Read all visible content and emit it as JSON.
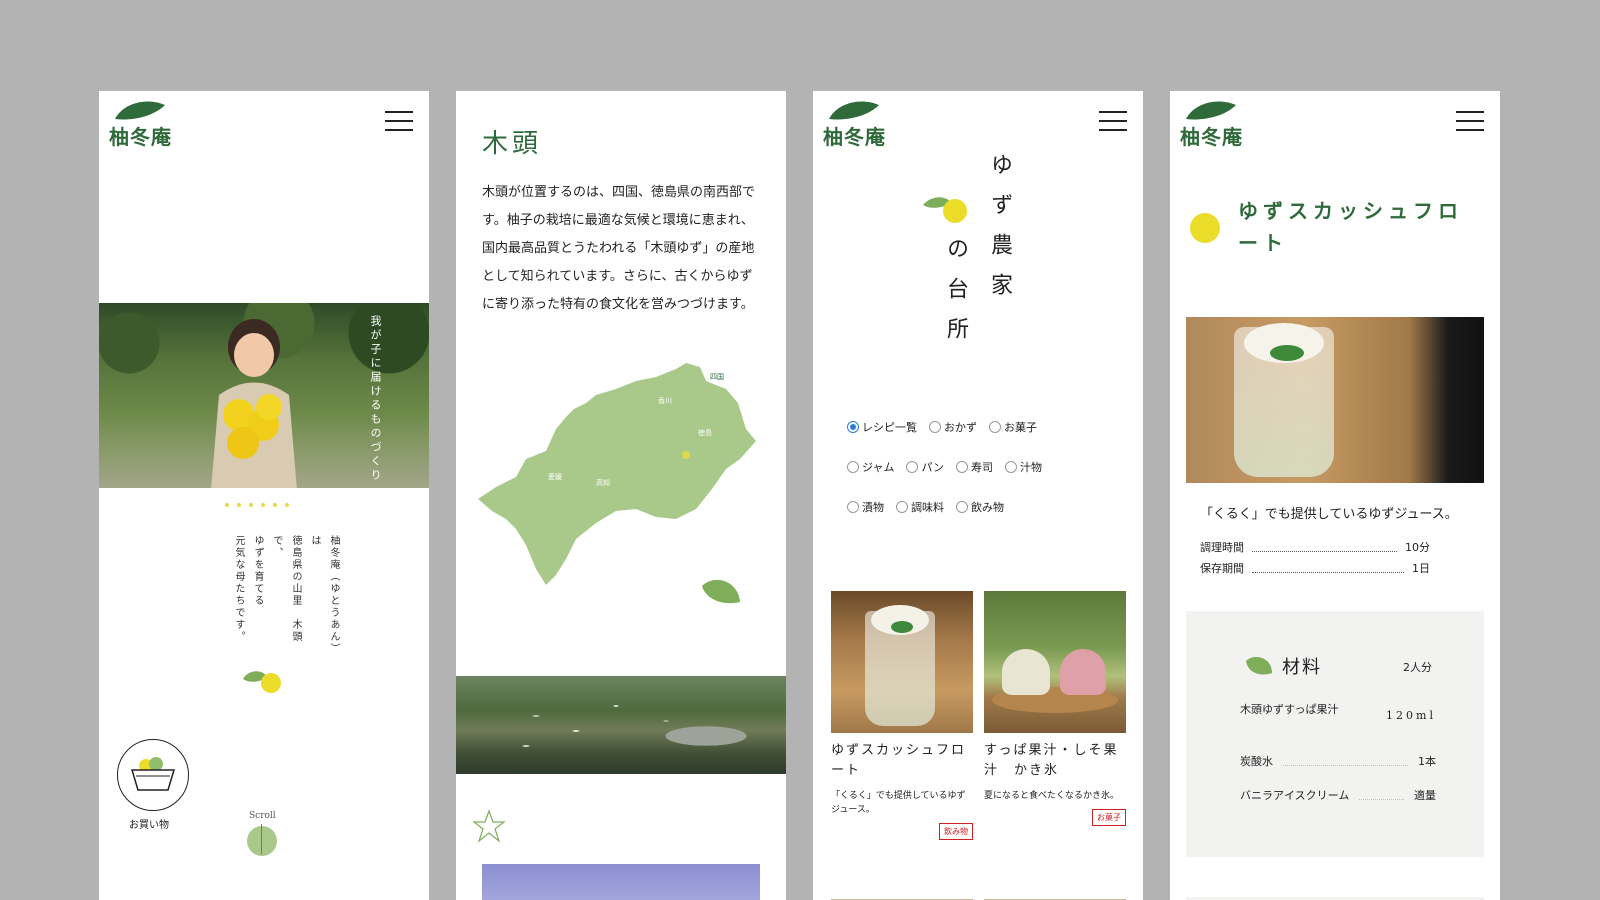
{
  "brand": {
    "logo_text": "柚冬庵",
    "green": "#2f6b3a",
    "yuzu_yellow": "#ecdc2a"
  },
  "screen1": {
    "hero_tagline": "我が子に届けるものづくり",
    "intro_lines": [
      "柚冬庵（ゆとうあん）は",
      "徳島県の山里　木頭で、",
      "ゆずを育てる",
      "元気な母たちです。"
    ],
    "shop_label": "お買い物",
    "scroll_label": "Scroll"
  },
  "screen2": {
    "title": "木頭",
    "body": "木頭が位置するのは、四国、徳島県の南西部です。柚子の栽培に最適な気候と環境に恵まれ、国内最高品質とうたわれる「木頭ゆず」の産地として知られています。さらに、古くからゆずに寄り添った特有の食文化を営みつづけます。",
    "map_labels": {
      "shikoku": "四国",
      "kagawa": "香川",
      "tokushima": "徳島",
      "ehime": "愛媛",
      "kochi": "高知"
    }
  },
  "screen3": {
    "title_col1": "ゆず農家",
    "title_col2": "の台所",
    "filters": [
      [
        {
          "label": "レシピ一覧",
          "checked": true
        },
        {
          "label": "おかず",
          "checked": false
        },
        {
          "label": "お菓子",
          "checked": false
        }
      ],
      [
        {
          "label": "ジャム",
          "checked": false
        },
        {
          "label": "パン",
          "checked": false
        },
        {
          "label": "寿司",
          "checked": false
        },
        {
          "label": "汁物",
          "checked": false
        }
      ],
      [
        {
          "label": "漬物",
          "checked": false
        },
        {
          "label": "調味料",
          "checked": false
        },
        {
          "label": "飲み物",
          "checked": false
        }
      ]
    ],
    "cards": [
      {
        "title": "ゆずスカッシュフロート",
        "desc": "「くるく」でも提供しているゆずジュース。",
        "tag": "飲み物"
      },
      {
        "title": "すっぱ果汁・しそ果汁　かき氷",
        "desc": "夏になると食べたくなるかき氷。",
        "tag": "お菓子"
      }
    ]
  },
  "screen4": {
    "title": "ゆずスカッシュフロート",
    "desc": "「くるく」でも提供しているゆずジュース。",
    "times": [
      {
        "label": "調理時間",
        "value": "10分"
      },
      {
        "label": "保存期間",
        "value": "1日"
      }
    ],
    "ingredients_title": "材料",
    "servings": "2人分",
    "ingredients": [
      {
        "name": "木頭ゆずすっぱ果汁",
        "qty": "120ml"
      },
      {
        "name": "炭酸水",
        "qty": "1本"
      },
      {
        "name": "バニラアイスクリーム",
        "qty": "適量"
      }
    ]
  }
}
